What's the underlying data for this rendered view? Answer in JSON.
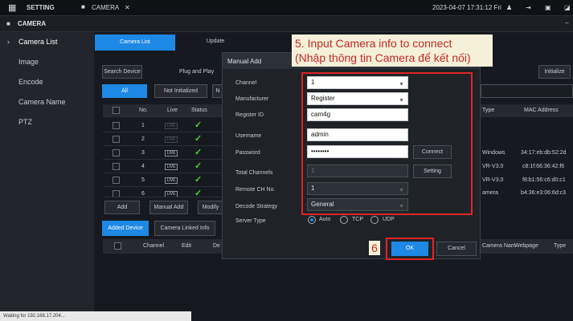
{
  "topbar": {
    "setting": "SETTING",
    "camera_tab": "CAMERA",
    "datetime": "2023-04-07 17:31:12 Fri"
  },
  "nav_title": "CAMERA",
  "sidebar": {
    "items": [
      {
        "label": "Camera List"
      },
      {
        "label": "Image"
      },
      {
        "label": "Encode"
      },
      {
        "label": "Camera Name"
      },
      {
        "label": "PTZ"
      }
    ]
  },
  "tabs": {
    "camera_list": "Camera List",
    "update": "Update"
  },
  "toolbar": {
    "search_device": "Search Device",
    "plug_play": "Plug and Play",
    "initialize": "Initialize",
    "all": "All",
    "not_initialized": "Not Initialized",
    "n_trunc": "N"
  },
  "table": {
    "headers": {
      "no": "No.",
      "live": "Live",
      "status": "Status",
      "type": "Type",
      "mac": "MAC Address"
    },
    "rows": [
      {
        "no": "1",
        "type": "",
        "mac": ""
      },
      {
        "no": "2",
        "type": "",
        "mac": ""
      },
      {
        "no": "3",
        "type": "Windows",
        "mac": "34:17:eb:db:52:2d"
      },
      {
        "no": "4",
        "type": "VR-V3.0",
        "mac": "c8:1f:66:36:42:f6"
      },
      {
        "no": "5",
        "type": "VR-V3.0",
        "mac": "f8:b1:56:c6:d0:c1"
      },
      {
        "no": "6",
        "type": "amera",
        "mac": "b4:36:e3:06:6d:c3"
      }
    ],
    "live_label": "LIVE"
  },
  "actions": {
    "add": "Add",
    "manual_add": "Manual Add",
    "modify": "Modify"
  },
  "bottom_tabs": {
    "added_device": "Added Device",
    "camera_linked_info": "Camera Linked Info"
  },
  "bottom_headers": {
    "channel": "Channel",
    "edit": "Edit",
    "de": "De",
    "camera_name": "Camera Nam",
    "webpage": "Webpage",
    "type": "Type"
  },
  "modal": {
    "title": "Manual Add",
    "labels": {
      "channel": "Channel",
      "manufacturer": "Manufacturer",
      "register_id": "Register ID",
      "username": "Username",
      "password": "Password",
      "total_channels": "Total Channels",
      "remote_ch_no": "Remote CH No.",
      "decode_strategy": "Decode Strategy",
      "server_type": "Server Type"
    },
    "values": {
      "channel": "1",
      "manufacturer": "Register",
      "register_id": "cam4g",
      "username": "admin",
      "password": "••••••••",
      "total_channels": "1",
      "remote_ch_no": "1",
      "decode_strategy": "General"
    },
    "connect": "Connect",
    "setting": "Setting",
    "server_options": [
      "Auto",
      "TCP",
      "UDP"
    ],
    "ok": "OK",
    "cancel": "Cancel"
  },
  "annotation": {
    "step5_line1": "5. Input Camera info to connect",
    "step5_line2": "(Nhập thông tin Camera để kết nối)",
    "step6": "6"
  },
  "status_bar": "Waiting for 192.168.17.204..."
}
